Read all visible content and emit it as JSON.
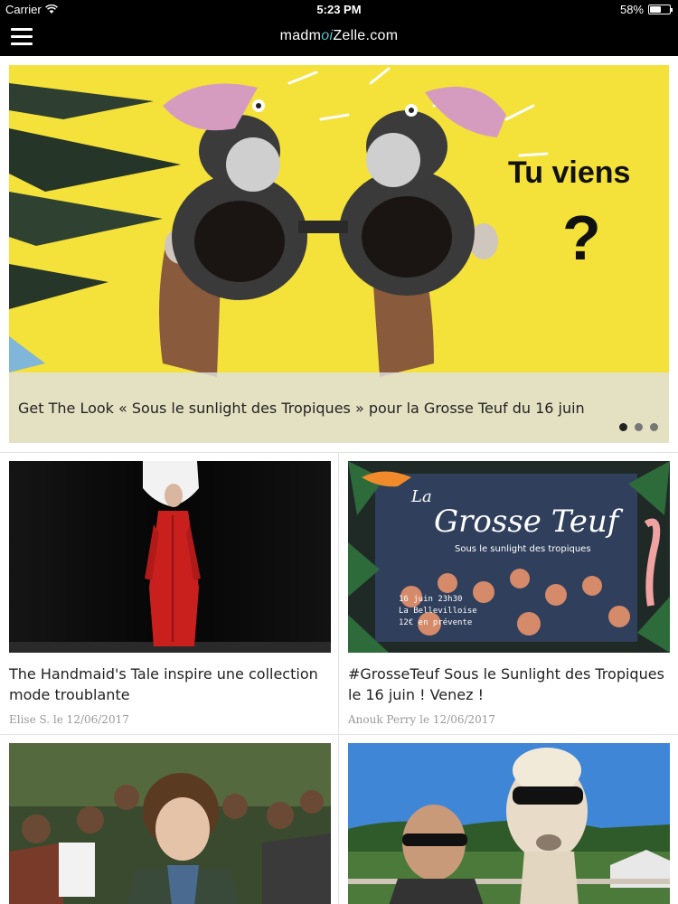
{
  "status": {
    "carrier": "Carrier",
    "time": "5:23 PM",
    "battery": "58%",
    "battery_level": 0.58
  },
  "nav": {
    "logo_pre": "madm",
    "logo_accent": "oi",
    "logo_post": "Zelle.com"
  },
  "hero": {
    "title": "Get The Look « Sous le sunlight des Tropiques » pour la Grosse Teuf du 16 juin",
    "image_text": [
      "Tu viens",
      "?"
    ],
    "dots": 3,
    "active_dot": 0
  },
  "articles": [
    {
      "title": "The Handmaid's Tale inspire une collection mode troublante",
      "meta": "Elise S. le 12/06/2017"
    },
    {
      "title": "#GrosseTeuf Sous le Sunlight des Tropiques le 16 juin ! Venez !",
      "meta": "Anouk Perry le 12/06/2017",
      "image_text": {
        "line1": "La",
        "line2": "Grosse Teuf",
        "line3": "Sous le sunlight des tropiques",
        "info": [
          "16 juin 23h30",
          "La Bellevilloise",
          "12€ en prévente"
        ]
      }
    }
  ]
}
